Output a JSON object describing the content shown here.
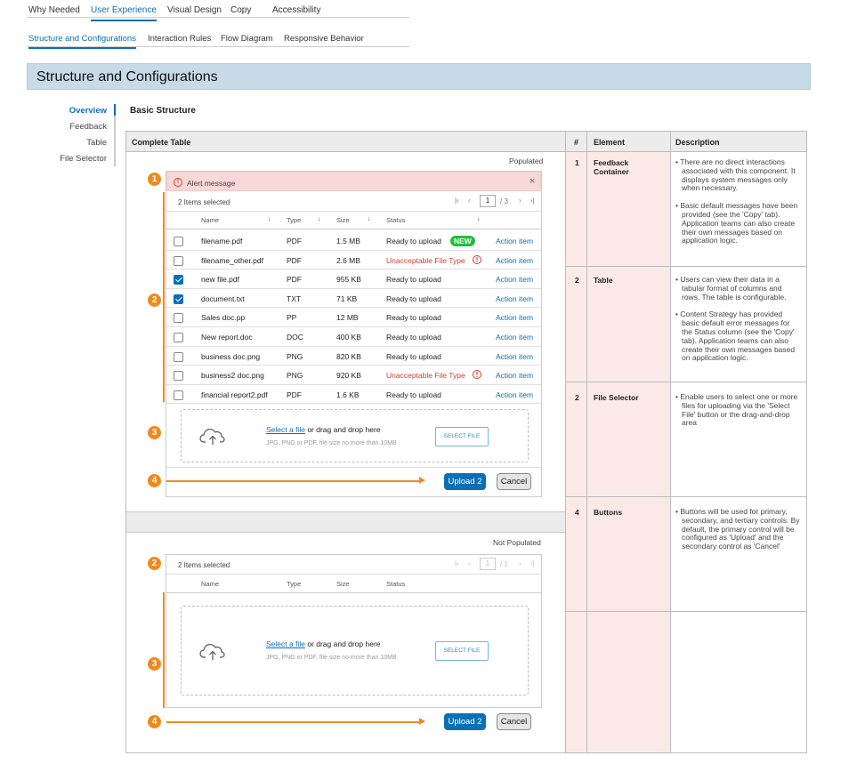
{
  "top_tabs": [
    "Why Needed",
    "User Experience",
    "Visual Design",
    "Copy",
    "Accessibility"
  ],
  "sub_tabs": [
    "Structure and Configurations",
    "Interaction Rules",
    "Flow Diagram",
    "Responsive Behavior"
  ],
  "banner_title": "Structure and Configurations",
  "left_nav": [
    "Overview",
    "Feedback",
    "Table",
    "File Selector"
  ],
  "section_title": "Basic Structure",
  "table_headers": {
    "preview": "Complete Table",
    "num": "#",
    "element": "Element",
    "description": "Description"
  },
  "rows": [
    {
      "num": "1",
      "element": "Feedback Container",
      "desc": [
        "There are no direct interactions associated with this component. It displays system messages only when necessary.",
        "Basic default messages have been provided (see the 'Copy' tab). Application teams can also create their own messages based on application logic."
      ]
    },
    {
      "num": "2",
      "element": "Table",
      "desc": [
        "Users can view their data in a tabular format of columns and rows. The table is configurable.",
        "Content Strategy has provided basic default error messages for the Status column (see the 'Copy' tab). Application teams can also create their own messages based on application logic."
      ]
    },
    {
      "num": "2",
      "element": "File Selector",
      "desc": [
        "Enable users to select one or more files for uploading via the 'Select File' button or the drag-and-drop area"
      ]
    },
    {
      "num": "4",
      "element": "Buttons",
      "desc": [
        "Buttons will be used for primary, secondary, and tertiary controls. By default, the primary control will be configured as 'Upload' and the secondary control as 'Cancel'"
      ]
    }
  ],
  "populated": {
    "label": "Populated",
    "alert": "Alert message",
    "selected": "2 Items selected",
    "page_current": "1",
    "page_total": "/ 3",
    "columns": [
      "Name",
      "Type",
      "Size",
      "Status"
    ],
    "files": [
      {
        "name": "filename.pdf",
        "type": "PDF",
        "size": "1.5 MB",
        "status": "Ready to upload",
        "action": "Action item",
        "checked": false,
        "error": false,
        "new": true
      },
      {
        "name": "filename_other.pdf",
        "type": "PDF",
        "size": "2.6 MB",
        "status": "Unacceptable File Type",
        "action": "Action item",
        "checked": false,
        "error": true,
        "new": false
      },
      {
        "name": "new file.pdf",
        "type": "PDF",
        "size": "955 KB",
        "status": "Ready to upload",
        "action": "Action item",
        "checked": true,
        "error": false,
        "new": false
      },
      {
        "name": "document.txt",
        "type": "TXT",
        "size": "71 KB",
        "status": "Ready to upload",
        "action": "Action item",
        "checked": true,
        "error": false,
        "new": false
      },
      {
        "name": "Sales doc.pp",
        "type": "PP",
        "size": "12 MB",
        "status": "Ready to upload",
        "action": "Action item",
        "checked": false,
        "error": false,
        "new": false
      },
      {
        "name": "New report.doc",
        "type": "DOC",
        "size": "400 KB",
        "status": "Ready to upload",
        "action": "Action item",
        "checked": false,
        "error": false,
        "new": false
      },
      {
        "name": "business doc.png",
        "type": "PNG",
        "size": "820 KB",
        "status": "Ready to upload",
        "action": "Action item",
        "checked": false,
        "error": false,
        "new": false
      },
      {
        "name": "business2 doc.png",
        "type": "PNG",
        "size": "920 KB",
        "status": "Unacceptable File Type",
        "action": "Action item",
        "checked": false,
        "error": true,
        "new": false
      },
      {
        "name": "financial report2.pdf",
        "type": "PDF",
        "size": "1.6 KB",
        "status": "Ready to upload",
        "action": "Action item",
        "checked": false,
        "error": false,
        "new": false
      }
    ],
    "new_badge": "NEW",
    "upload_button": "Upload 2",
    "cancel_button": "Cancel"
  },
  "not_populated": {
    "label": "Not Populated",
    "selected": "2 Items selected",
    "page_current": "1",
    "page_total": "/ 1",
    "columns": [
      "Name",
      "Type",
      "Size",
      "Status"
    ],
    "upload_button": "Upload 2",
    "cancel_button": "Cancel"
  },
  "drop": {
    "link": "Select a file",
    "text": " or drag and drop here",
    "hint": "JPG, PNG or PDF, file size no more than 10MB",
    "button": "SELECT FILE"
  },
  "badges": [
    "1",
    "2",
    "3",
    "4"
  ],
  "colors": {
    "accent": "#0a6fb6",
    "orange": "#ef8a1f",
    "error": "#d63b2f",
    "banner": "#c7dae8",
    "new": "#1fbf3a"
  }
}
